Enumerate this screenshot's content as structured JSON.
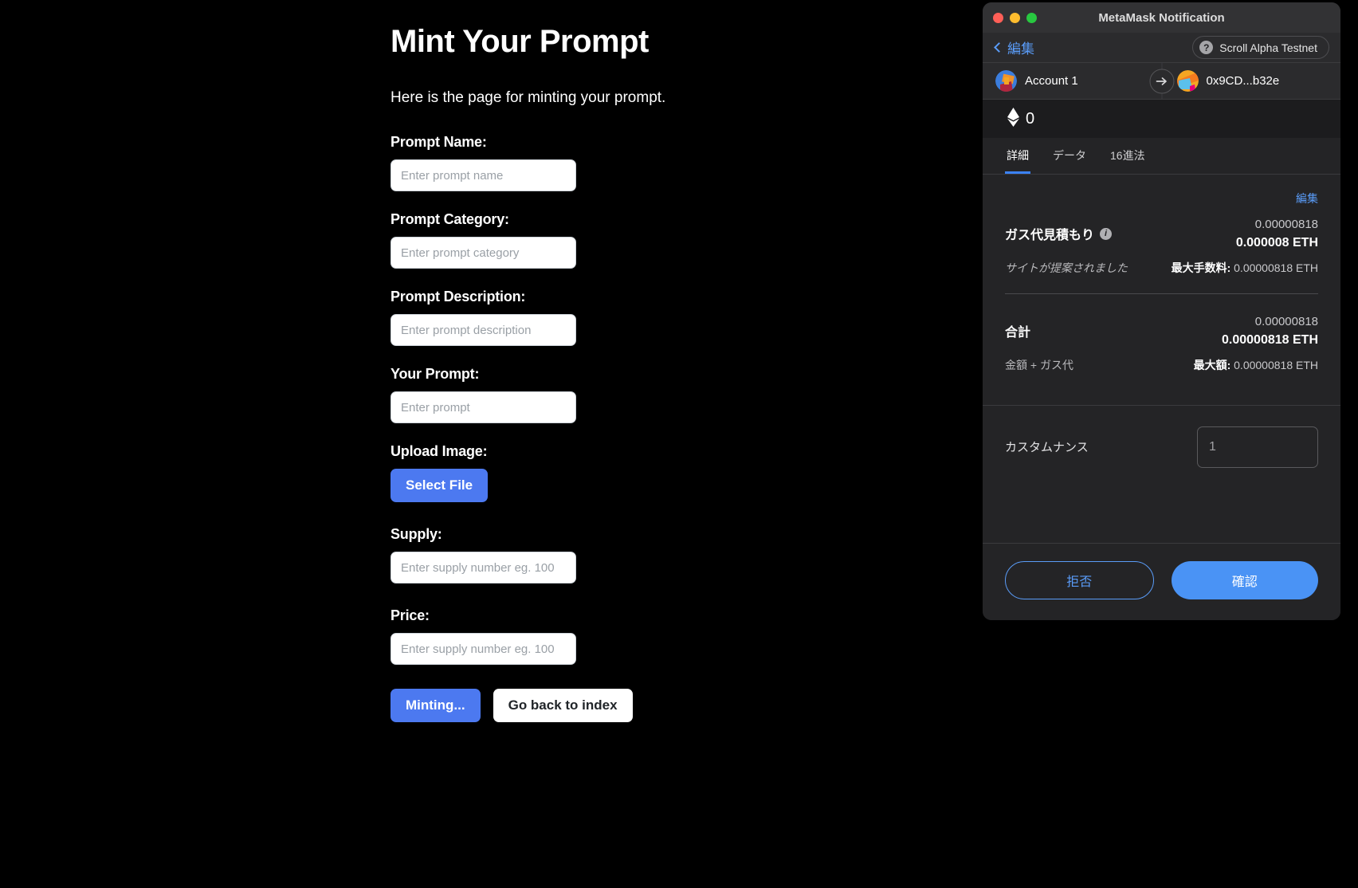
{
  "dapp": {
    "title": "Mint Your Prompt",
    "subtitle": "Here is the page for minting your prompt.",
    "fields": [
      {
        "label": "Prompt Name:",
        "placeholder": "Enter prompt name",
        "value": ""
      },
      {
        "label": "Prompt Category:",
        "placeholder": "Enter prompt category",
        "value": ""
      },
      {
        "label": "Prompt Description:",
        "placeholder": "Enter prompt description",
        "value": ""
      },
      {
        "label": "Your Prompt:",
        "placeholder": "Enter prompt",
        "value": ""
      }
    ],
    "upload": {
      "label": "Upload Image:",
      "button_label": "Select File"
    },
    "fields2": [
      {
        "label": "Supply:",
        "placeholder": "Enter supply number eg. 100",
        "value": ""
      },
      {
        "label": "Price:",
        "placeholder": "Enter supply number eg. 100",
        "value": ""
      }
    ],
    "actions": {
      "mint_label": "Minting...",
      "back_label": "Go back to index"
    },
    "colors": {
      "accent": "#4c79f0",
      "background": "#000000",
      "input_background": "#ffffff"
    }
  },
  "metamask": {
    "window_title": "MetaMask Notification",
    "traffic_lights": [
      "close-red",
      "minimize-yellow",
      "maximize-green"
    ],
    "nav": {
      "back_label": "編集",
      "back_icon": "chevron-left-icon",
      "network_icon": "question-mark-icon",
      "network_label": "Scroll Alpha Testnet"
    },
    "accounts": {
      "from_name": "Account 1",
      "from_avatar": "account-jazzicon",
      "arrow_icon": "arrow-right-icon",
      "to_name": "0x9CD...b32e",
      "to_avatar": "contract-jazzicon"
    },
    "amount": {
      "currency_icon": "ethereum-icon",
      "value": "0"
    },
    "tabs": [
      {
        "label": "詳細",
        "active": true
      },
      {
        "label": "データ",
        "active": false
      },
      {
        "label": "16進法",
        "active": false
      }
    ],
    "details": {
      "edit_label": "編集",
      "gas": {
        "label": "ガス代見積もり",
        "info_icon": "info-icon",
        "fiat": "0.00000818",
        "eth": "0.000008 ETH",
        "sub_left": "サイトが提案されました",
        "sub_right_label": "最大手数料:",
        "sub_right_value": "0.00000818 ETH"
      },
      "total": {
        "label": "合計",
        "fiat": "0.00000818",
        "eth": "0.00000818 ETH",
        "sub_left": "金額 + ガス代",
        "sub_right_label": "最大額:",
        "sub_right_value": "0.00000818 ETH"
      },
      "nonce": {
        "label": "カスタムナンス",
        "placeholder": "1",
        "value": ""
      }
    },
    "footer": {
      "reject_label": "拒否",
      "confirm_label": "確認"
    },
    "colors": {
      "accent_blue": "#4a93f5",
      "link_blue": "#5a9cf8",
      "window_bg": "#242426",
      "titlebar_bg": "#323234"
    }
  }
}
